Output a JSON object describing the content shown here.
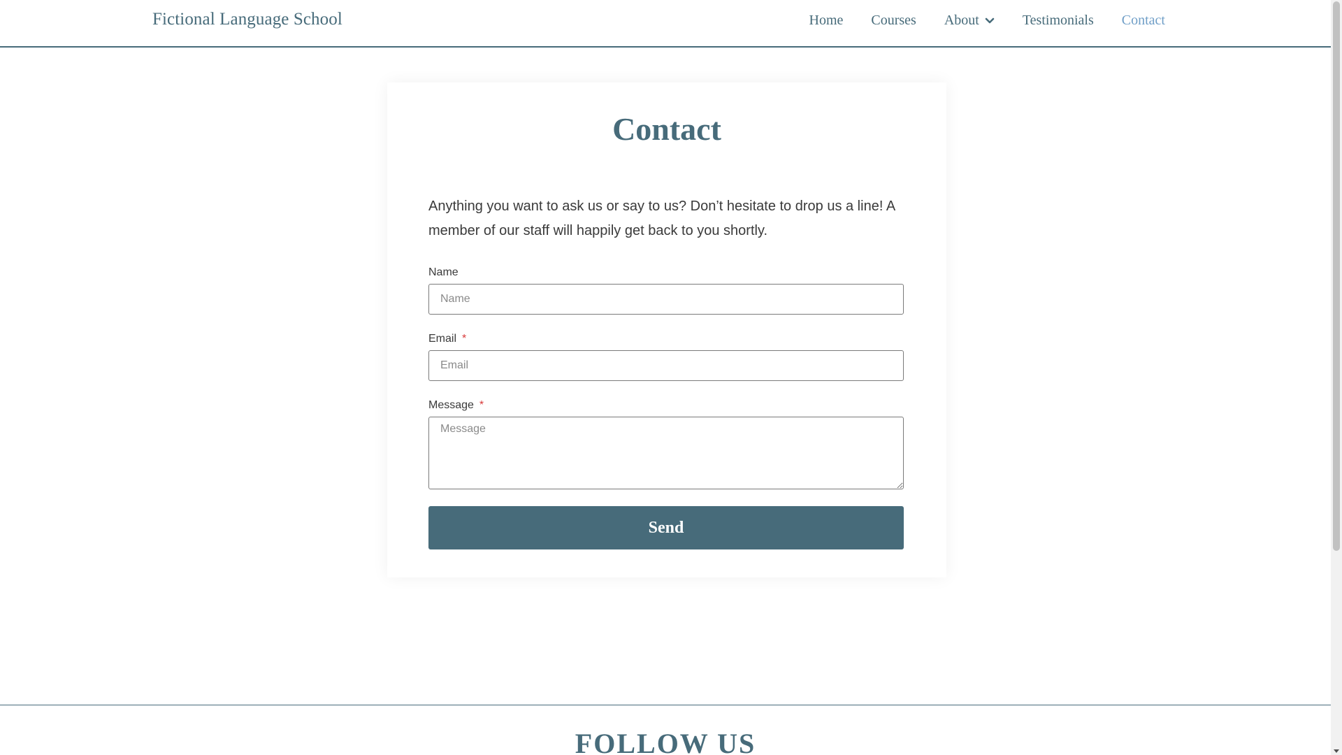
{
  "header": {
    "site_title": "Fictional Language School",
    "nav": [
      {
        "label": "Home"
      },
      {
        "label": "Courses"
      },
      {
        "label": "About",
        "has_dropdown": true
      },
      {
        "label": "Testimonials"
      },
      {
        "label": "Contact",
        "active": true
      }
    ]
  },
  "contact": {
    "title": "Contact",
    "intro": "Anything you want to ask us or say to us? Don’t hesitate to drop us a line! A member of our staff will happily get back to you shortly.",
    "fields": {
      "name": {
        "label": "Name",
        "placeholder": "Name",
        "required": false
      },
      "email": {
        "label": "Email",
        "placeholder": "Email",
        "required": true
      },
      "message": {
        "label": "Message",
        "placeholder": "Message",
        "required": true
      }
    },
    "required_marker": "*",
    "send_label": "Send"
  },
  "footer": {
    "follow_heading": "FOLLOW US"
  },
  "colors": {
    "brand": "#476b7a",
    "nav_active": "#6f9ec7",
    "required": "#d83a3a"
  }
}
